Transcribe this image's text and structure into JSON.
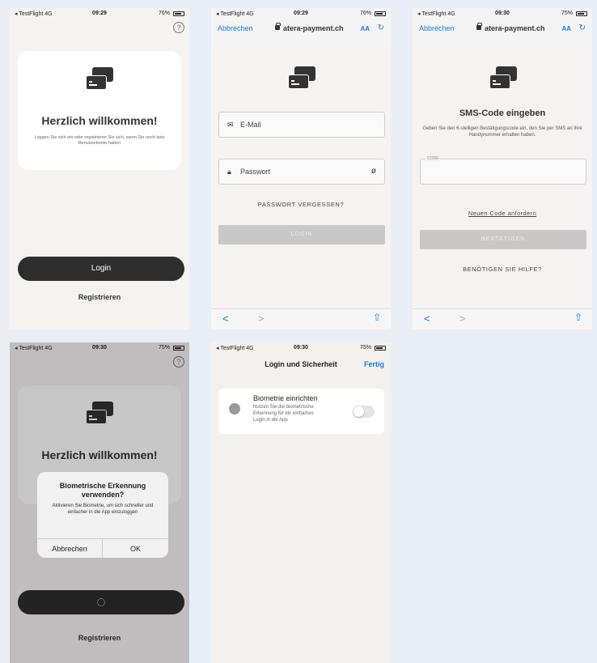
{
  "status": {
    "carrier": "◂ TestFlight 4G",
    "p1": {
      "time": "09:29",
      "battery": "76%"
    },
    "p2": {
      "time": "09:29",
      "battery": "76%"
    },
    "p3": {
      "time": "09:30",
      "battery": "75%"
    },
    "p4": {
      "time": "09:30",
      "battery": "75%"
    },
    "p5": {
      "time": "09:30",
      "battery": "75%"
    }
  },
  "welcome": {
    "help_icon": "?",
    "title": "Herzlich willkommen!",
    "subtitle": "Loggen Sie sich ein oder registrieren Sie sich, wenn Sie noch kein Benutzerkonto haben",
    "login_button": "Login",
    "register_link": "Registrieren"
  },
  "browser": {
    "cancel": "Abbrechen",
    "url": "atera-payment.ch",
    "aa": "AA",
    "reload": "↻",
    "back": "<",
    "forward": ">",
    "share": "⇧"
  },
  "login_form": {
    "email_placeholder": "E-Mail",
    "password_placeholder": "Passwort",
    "forgot_password": "PASSWORT VERGESSEN?",
    "login_button": "LOGIN"
  },
  "sms": {
    "title": "SMS-Code eingeben",
    "subtitle": "Geben Sie den 6-stelligen Bestätigungscode ein, den Sie per SMS an Ihre Handynummer erhalten haben.",
    "code_label": "CODE",
    "new_code": "Neuen Code anfordern",
    "confirm_button": "BESTÄTIGEN",
    "need_help": "BENÖTIGEN SIE HILFE?"
  },
  "biometric_dialog": {
    "title": "Biometrische Erkennung verwenden?",
    "message": "Aktivieren Sie Biometrie, um sich schneller und einfacher in die App einzuloggen",
    "cancel": "Abbrechen",
    "ok": "OK"
  },
  "settings": {
    "nav_title": "Login und Sicherheit",
    "done": "Fertig",
    "biometric_title": "Biometrie einrichten",
    "biometric_desc": "Nutzen Sie die biometrische Erkennung für ein einfaches Login in die App",
    "toggle_on": false
  }
}
